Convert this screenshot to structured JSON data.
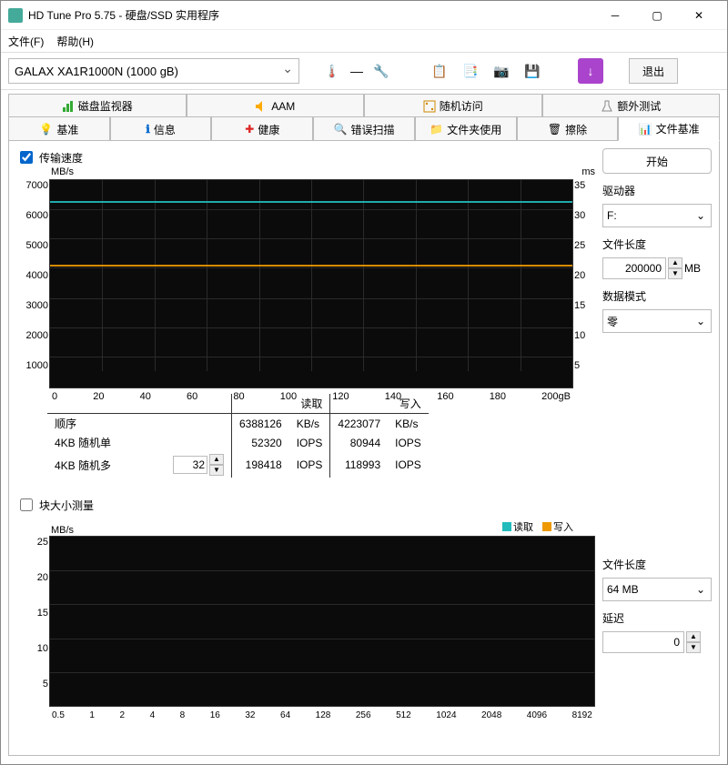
{
  "window": {
    "title": "HD Tune Pro 5.75 - 硬盘/SSD 实用程序"
  },
  "menubar": {
    "file": "文件(F)",
    "help": "帮助(H)"
  },
  "toolbar": {
    "drive_selected": "GALAX XA1R1000N (1000 gB)",
    "exit": "退出"
  },
  "tabs_row1": {
    "disk_monitor": "磁盘监视器",
    "aam": "AAM",
    "random_access": "随机访问",
    "extra_tests": "额外测试"
  },
  "tabs_row2": {
    "benchmark": "基准",
    "info": "信息",
    "health": "健康",
    "error_scan": "错误扫描",
    "folder_usage": "文件夹使用",
    "erase": "擦除",
    "file_benchmark": "文件基准"
  },
  "panel": {
    "transfer_rate_label": "传输速度",
    "start": "开始",
    "drive_label": "驱动器",
    "drive_value": "F:",
    "file_length_label": "文件长度",
    "file_length_value": "200000",
    "file_length_unit": "MB",
    "data_pattern_label": "数据模式",
    "data_pattern_value": "零",
    "block_size_label": "块大小测量",
    "file_length2_label": "文件长度",
    "file_length2_value": "64 MB",
    "delay_label": "延迟",
    "delay_value": "0"
  },
  "results": {
    "col_read": "读取",
    "col_write": "写入",
    "row_seq": "顺序",
    "row_4k_single": "4KB 随机单",
    "row_4k_multi": "4KB 随机多",
    "multi_queue": "32",
    "seq_read": "6388126",
    "seq_read_unit": "KB/s",
    "seq_write": "4223077",
    "seq_write_unit": "KB/s",
    "r4ks_read": "52320",
    "r4ks_read_unit": "IOPS",
    "r4ks_write": "80944",
    "r4ks_write_unit": "IOPS",
    "r4km_read": "198418",
    "r4km_read_unit": "IOPS",
    "r4km_write": "118993",
    "r4km_write_unit": "IOPS"
  },
  "legend": {
    "read": "读取",
    "write": "写入"
  },
  "chart_data": [
    {
      "type": "line",
      "title": "",
      "xlabel": "gB",
      "ylabel_left": "MB/s",
      "ylabel_right": "ms",
      "x_ticks": [
        0,
        20,
        40,
        60,
        80,
        100,
        120,
        140,
        160,
        180,
        "200gB"
      ],
      "y_ticks_left": [
        7000,
        6000,
        5000,
        4000,
        3000,
        2000,
        1000
      ],
      "y_ticks_right": [
        35,
        30,
        25,
        20,
        15,
        10,
        5
      ],
      "ylim_left": [
        0,
        7000
      ],
      "ylim_right": [
        0,
        35
      ],
      "series": [
        {
          "name": "读取",
          "axis": "left",
          "approx_constant_value": 6300,
          "color": "#22bbbb"
        },
        {
          "name": "写入",
          "axis": "left",
          "approx_constant_value": 4100,
          "color": "#ee9900"
        }
      ]
    },
    {
      "type": "line",
      "title": "",
      "xlabel": "block size",
      "ylabel_left": "MB/s",
      "x_ticks": [
        0.5,
        1,
        2,
        4,
        8,
        16,
        32,
        64,
        128,
        256,
        512,
        1024,
        2048,
        4096,
        8192
      ],
      "y_ticks_left": [
        25,
        20,
        15,
        10,
        5
      ],
      "ylim_left": [
        0,
        25
      ],
      "series": [
        {
          "name": "读取",
          "values": [],
          "color": "#22bbbb"
        },
        {
          "name": "写入",
          "values": [],
          "color": "#ee9900"
        }
      ]
    }
  ]
}
